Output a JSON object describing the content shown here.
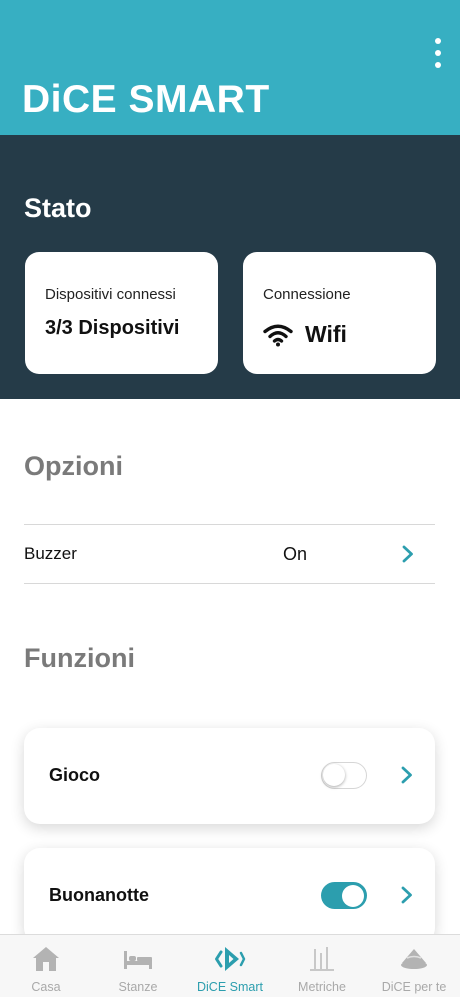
{
  "header": {
    "title": "DiCE SMART",
    "menu_icon": "more-vertical-icon"
  },
  "status": {
    "title": "Stato",
    "devices_card": {
      "label": "Dispositivi connessi",
      "value": "3/3 Dispositivi"
    },
    "connection_card": {
      "label": "Connessione",
      "value": "Wifi",
      "icon": "wifi-icon"
    }
  },
  "options": {
    "title": "Opzioni",
    "items": [
      {
        "label": "Buzzer",
        "value": "On"
      }
    ]
  },
  "functions": {
    "title": "Funzioni",
    "items": [
      {
        "label": "Gioco",
        "enabled": false
      },
      {
        "label": "Buonanotte",
        "enabled": true
      }
    ]
  },
  "tabbar": {
    "items": [
      {
        "label": "Casa",
        "icon": "house-icon",
        "active": false
      },
      {
        "label": "Stanze",
        "icon": "bed-icon",
        "active": false
      },
      {
        "label": "DiCE Smart",
        "icon": "dice-logo-icon",
        "active": true
      },
      {
        "label": "Metriche",
        "icon": "chart-icon",
        "active": false
      },
      {
        "label": "DiCE per te",
        "icon": "dice-device-icon",
        "active": false
      }
    ]
  },
  "colors": {
    "header_bg": "#37afc2",
    "status_bg": "#253b48",
    "accent": "#2c9eae",
    "tab_inactive": "#a9a9a9"
  }
}
